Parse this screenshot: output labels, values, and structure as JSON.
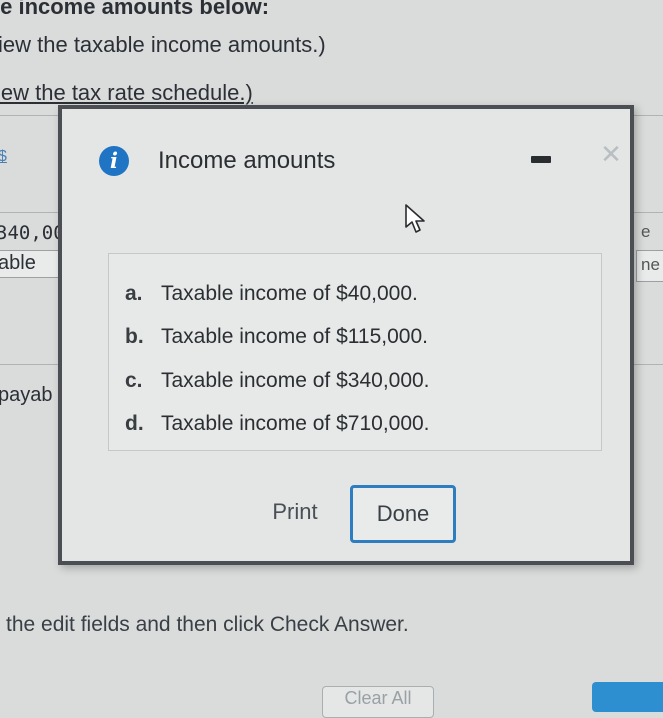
{
  "background": {
    "instruction_line_1": "le income amounts below:",
    "instruction_line_2": "iew the taxable income amounts.)",
    "instruction_line_3": "iew the tax rate schedule.)",
    "fragments": {
      "col_marker": "$",
      "amount": "340,00",
      "taxable": "able",
      "payable": "payab",
      "right_1": "e",
      "right_2": "ne"
    },
    "bottom_instruction": "the edit fields and then click Check Answer.",
    "clear_all_label": "Clear All"
  },
  "dialog": {
    "title": "Income amounts",
    "info_icon": "info-icon",
    "minimize_icon": "minimize-icon",
    "close_icon": "close-icon",
    "close_glyph": "✕",
    "cursor_icon": "cursor-arrow-icon",
    "items": [
      {
        "letter": "a.",
        "text": "Taxable income of $40,000."
      },
      {
        "letter": "b.",
        "text": "Taxable income of $115,000."
      },
      {
        "letter": "c.",
        "text": "Taxable income of $340,000."
      },
      {
        "letter": "d.",
        "text": "Taxable income of $710,000."
      }
    ],
    "print_label": "Print",
    "done_label": "Done"
  },
  "colors": {
    "accent": "#2f7dc1",
    "info_icon": "#1f74c4",
    "background": "#d9dcdb",
    "dialog_border": "#4b4f53"
  }
}
